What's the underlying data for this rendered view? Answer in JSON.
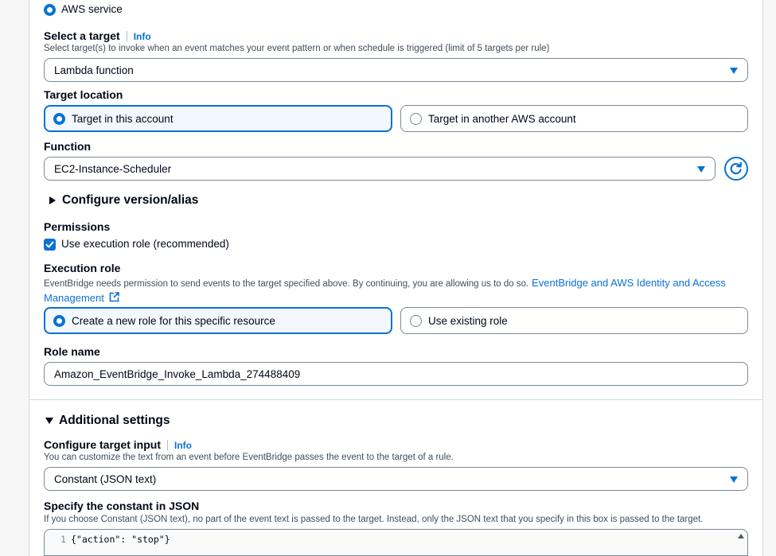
{
  "event_target": {
    "aws_service_label": "AWS service"
  },
  "select_target": {
    "label": "Select a target",
    "info": "Info",
    "description": "Select target(s) to invoke when an event matches your event pattern or when schedule is triggered (limit of 5 targets per rule)",
    "value": "Lambda function"
  },
  "target_location": {
    "label": "Target location",
    "options": [
      "Target in this account",
      "Target in another AWS account"
    ]
  },
  "function": {
    "label": "Function",
    "value": "EC2-Instance-Scheduler"
  },
  "configure_version": {
    "label": "Configure version/alias"
  },
  "permissions": {
    "label": "Permissions",
    "checkbox_label": "Use execution role (recommended)"
  },
  "execution_role": {
    "label": "Execution role",
    "description": "EventBridge needs permission to send events to the target specified above. By continuing, you are allowing us to do so.",
    "link_line1": "EventBridge and AWS Identity and Access",
    "link_line2": "Management",
    "options": [
      "Create a new role for this specific resource",
      "Use existing role"
    ]
  },
  "role_name": {
    "label": "Role name",
    "value": "Amazon_EventBridge_Invoke_Lambda_274488409"
  },
  "additional_settings": {
    "label": "Additional settings"
  },
  "target_input": {
    "label": "Configure target input",
    "info": "Info",
    "description": "You can customize the text from an event before EventBridge passes the event to the target of a rule.",
    "value": "Constant (JSON text)"
  },
  "constant_json": {
    "label": "Specify the constant in JSON",
    "description": "If you choose Constant (JSON text), no part of the event text is passed to the target. Instead, only the JSON text that you specify in this box is passed to the target.",
    "line_number": "1",
    "code": "{\"action\": \"stop\"}"
  },
  "colors": {
    "accent": "#0972d3",
    "border": "#7d8998",
    "text": "#000716"
  }
}
